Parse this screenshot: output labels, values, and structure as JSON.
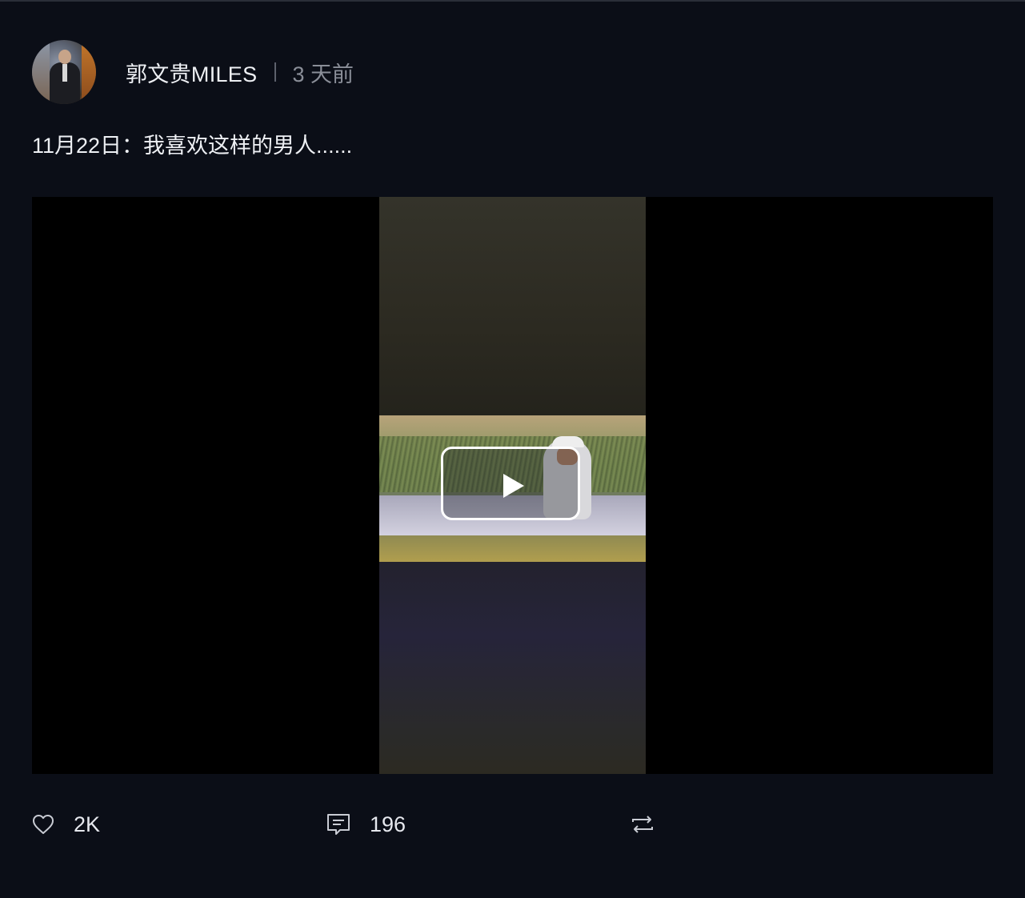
{
  "post": {
    "username": "郭文贵MILES",
    "time": "3 天前",
    "text": "11月22日：我喜欢这样的男人......"
  },
  "actions": {
    "like_count": "2K",
    "comment_count": "196",
    "repost_count": ""
  },
  "icons": {
    "like": "heart-icon",
    "comment": "comment-icon",
    "repost": "repost-icon",
    "play": "play-icon"
  },
  "colors": {
    "background": "#0b0e17",
    "text": "#eef0f4",
    "muted": "#8a8e98"
  }
}
